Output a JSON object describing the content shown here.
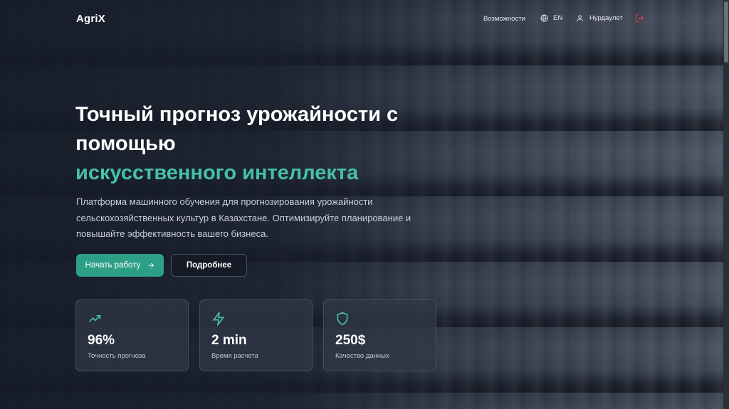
{
  "header": {
    "logo": "AgriX",
    "nav": {
      "features": "Возможности",
      "language": "EN",
      "user_name": "Нурдаулет"
    }
  },
  "hero": {
    "title_line1": "Точный прогноз урожайности с помощью",
    "title_accent": "искусственного интеллекта",
    "description": "Платформа машинного обучения для прогнозирования урожайности сельскохозяйственных культур в Казахстане. Оптимизируйте планирование и повышайте эффективность вашего бизнеса.",
    "primary_button": "Начать работу",
    "secondary_button": "Подробнее"
  },
  "stats": [
    {
      "icon": "trending-up-icon",
      "value": "96%",
      "label": "Точность прогноза"
    },
    {
      "icon": "lightning-icon",
      "value": "2 min",
      "label": "Время расчета"
    },
    {
      "icon": "shield-icon",
      "value": "250$",
      "label": "Качество данных"
    }
  ],
  "colors": {
    "accent": "#45c1a6",
    "primary_button": "#2d9f87",
    "logout_icon": "#e0454f"
  }
}
